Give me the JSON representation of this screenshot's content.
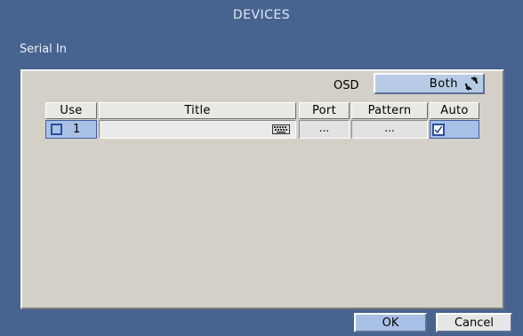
{
  "window": {
    "title": "DEVICES",
    "section": "Serial In"
  },
  "osd": {
    "label": "OSD",
    "value": "Both",
    "cycle_icon": "cycle-arrows-icon"
  },
  "table": {
    "headers": {
      "use": "Use",
      "title": "Title",
      "port": "Port",
      "pattern": "Pattern",
      "auto": "Auto"
    },
    "rows": [
      {
        "use_checked": false,
        "number": "1",
        "title": "",
        "title_icon": "keyboard-icon",
        "port": "...",
        "pattern": "...",
        "auto_checked": true
      }
    ]
  },
  "footer": {
    "ok_label": "OK",
    "cancel_label": "Cancel"
  },
  "colors": {
    "window_bg": "#47638f",
    "panel_bg": "#d4d0c8",
    "selected_bg": "#a9c0e6",
    "check_color": "#2c4ea0"
  }
}
